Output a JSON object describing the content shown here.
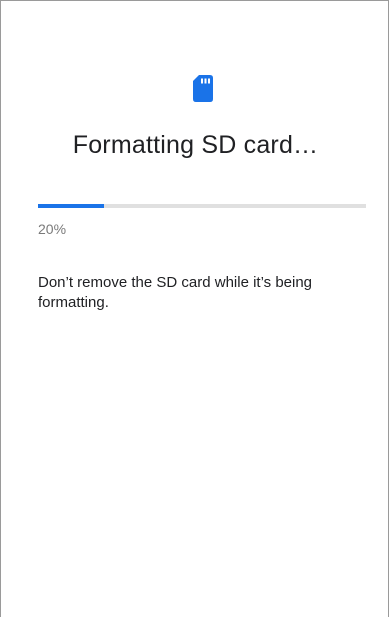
{
  "dialog": {
    "icon": "sd-card-icon",
    "title": "Formatting SD card…",
    "progress": {
      "value": 0.2,
      "label": "20%"
    },
    "message": "Don’t remove the SD card while it’s being formatting."
  },
  "colors": {
    "accent": "#1a73e8",
    "track": "#e0e0e0",
    "text": "#202124",
    "secondary_text": "#7a7a7a"
  }
}
